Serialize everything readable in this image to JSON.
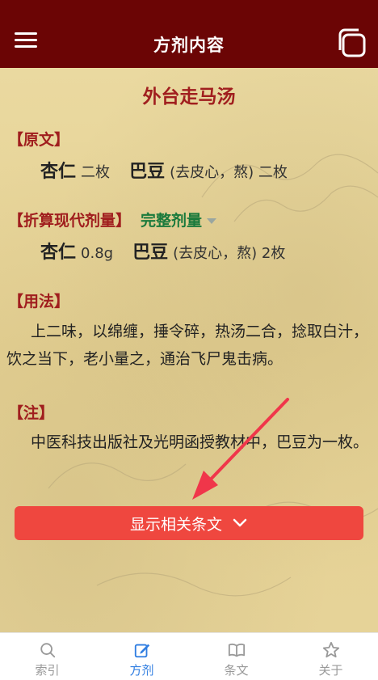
{
  "header": {
    "title": "方剂内容"
  },
  "recipe": {
    "name": "外台走马汤",
    "original": {
      "heading": "【原文】",
      "items": [
        {
          "herb": "杏仁",
          "dose": "二枚"
        },
        {
          "herb": "巴豆",
          "dose": "(去皮心，熬) 二枚"
        }
      ]
    },
    "modern": {
      "heading": "【折算现代剂量】",
      "toggle": "完整剂量",
      "items": [
        {
          "herb": "杏仁",
          "dose": "0.8g"
        },
        {
          "herb": "巴豆",
          "dose": "(去皮心，熬) 2枚"
        }
      ]
    },
    "usage": {
      "heading": "【用法】",
      "text": "上二味，以绵缠，捶令碎，热汤二合，捻取白汁，饮之当下，老小量之，通治飞尸鬼击病。"
    },
    "note": {
      "heading": "【注】",
      "text": "中医科技出版社及光明函授教材中，巴豆为一枚。"
    }
  },
  "actions": {
    "show_related": "显示相关条文"
  },
  "tabs": [
    {
      "label": "索引",
      "icon": "search-icon"
    },
    {
      "label": "方剂",
      "icon": "edit-icon"
    },
    {
      "label": "条文",
      "icon": "book-icon"
    },
    {
      "label": "关于",
      "icon": "star-icon"
    }
  ],
  "colors": {
    "header": "#6b0505",
    "accent_red": "#a01e1e",
    "button": "#ef473f",
    "green": "#1a7a3c",
    "tab_active": "#2f7de1"
  }
}
